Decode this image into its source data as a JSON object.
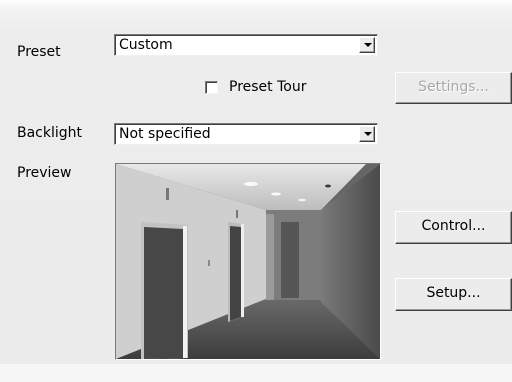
{
  "preset": {
    "label": "Preset",
    "value": "Custom"
  },
  "preset_tour": {
    "label": "Preset Tour",
    "checked": false
  },
  "settings_button": {
    "label": "Settings...",
    "enabled": false
  },
  "backlight": {
    "label": "Backlight",
    "value": "Not specified"
  },
  "preview": {
    "label": "Preview",
    "content": "camera-preview-hallway"
  },
  "control_button": {
    "label": "Control..."
  },
  "setup_button": {
    "label": "Setup..."
  }
}
